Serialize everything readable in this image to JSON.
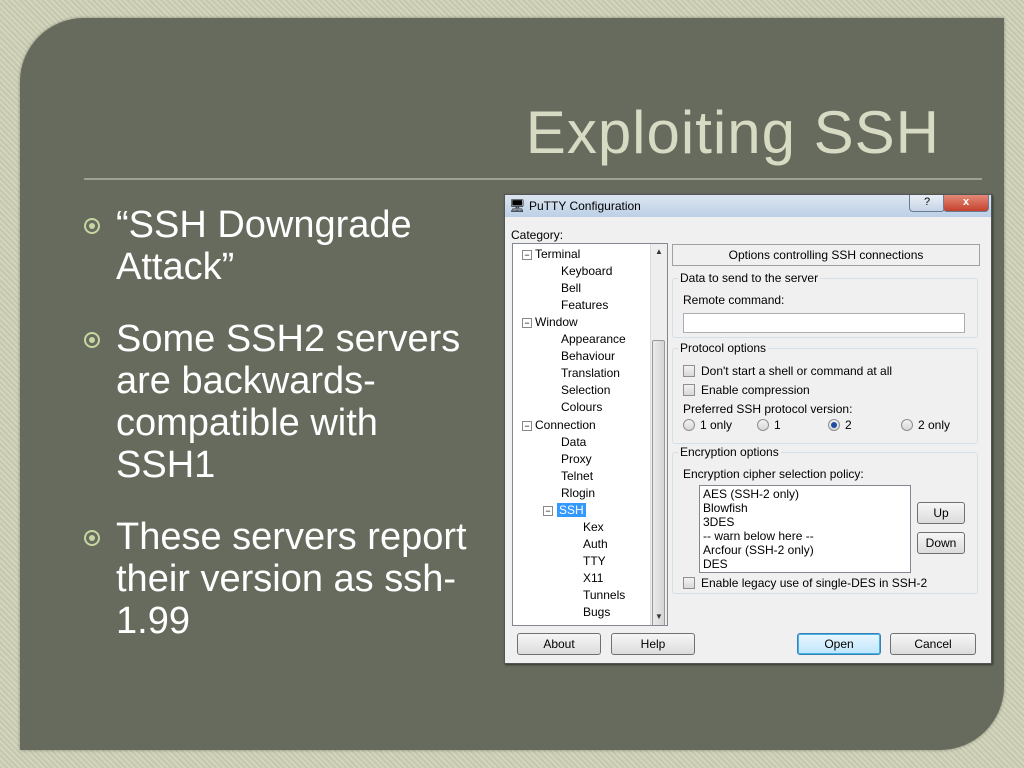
{
  "slide": {
    "title": "Exploiting SSH",
    "bullets": [
      "“SSH Downgrade Attack”",
      "Some SSH2 servers are backwards-compatible with SSH1",
      "These servers report their version as ssh-1.99"
    ]
  },
  "putty": {
    "window_title": "PuTTY Configuration",
    "help_glyph": "?",
    "close_glyph": "x",
    "category_label": "Category:",
    "tree": {
      "terminal": "Terminal",
      "keyboard": "Keyboard",
      "bell": "Bell",
      "features": "Features",
      "window": "Window",
      "appearance": "Appearance",
      "behaviour": "Behaviour",
      "translation": "Translation",
      "selection": "Selection",
      "colours": "Colours",
      "connection": "Connection",
      "data": "Data",
      "proxy": "Proxy",
      "telnet": "Telnet",
      "rlogin": "Rlogin",
      "ssh": "SSH",
      "kex": "Kex",
      "auth": "Auth",
      "tty": "TTY",
      "x11": "X11",
      "tunnels": "Tunnels",
      "bugs": "Bugs"
    },
    "panel_header": "Options controlling SSH connections",
    "data_group": {
      "title": "Data to send to the server",
      "remote_command_label": "Remote command:",
      "remote_command_value": ""
    },
    "protocol_group": {
      "title": "Protocol options",
      "no_shell_label": "Don't start a shell or command at all",
      "no_shell_checked": false,
      "compression_label": "Enable compression",
      "compression_checked": false,
      "version_label": "Preferred SSH protocol version:",
      "versions": [
        "1 only",
        "1",
        "2",
        "2 only"
      ],
      "selected_version": "2"
    },
    "encryption_group": {
      "title": "Encryption options",
      "policy_label": "Encryption cipher selection policy:",
      "ciphers": [
        "AES (SSH-2 only)",
        "Blowfish",
        "3DES",
        "-- warn below here --",
        "Arcfour (SSH-2 only)",
        "DES"
      ],
      "up_label": "Up",
      "down_label": "Down",
      "legacy_label": "Enable legacy use of single-DES in SSH-2",
      "legacy_checked": false
    },
    "buttons": {
      "about": "About",
      "help": "Help",
      "open": "Open",
      "cancel": "Cancel"
    }
  }
}
